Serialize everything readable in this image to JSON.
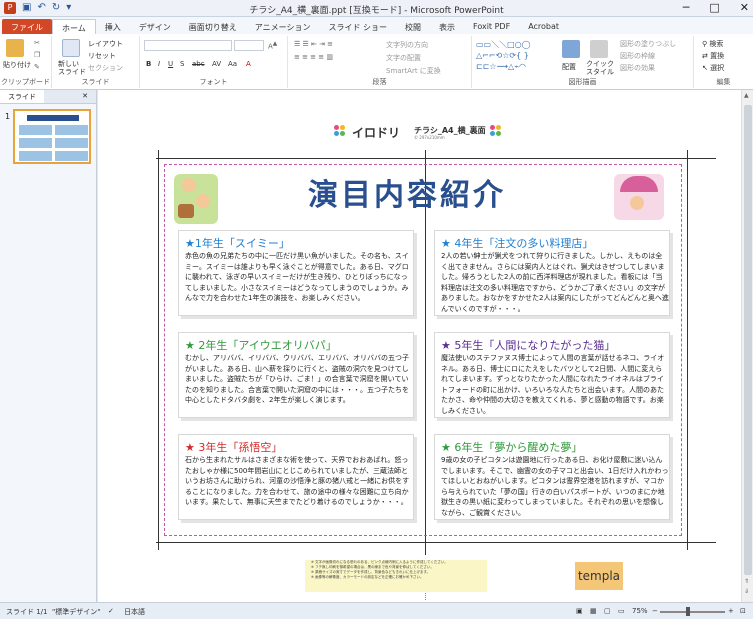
{
  "window": {
    "title": "チラシ_A4_横_裏面.ppt [互換モード] - Microsoft PowerPoint"
  },
  "ribbon_tabs": [
    "ファイル",
    "ホーム",
    "挿入",
    "デザイン",
    "画面切り替え",
    "アニメーション",
    "スライド ショー",
    "校閲",
    "表示",
    "Foxit PDF",
    "Acrobat"
  ],
  "ribbon": {
    "clipboard": {
      "paste": "貼り付け",
      "label": "クリップボード"
    },
    "slides": {
      "new": "新しい\nスライド",
      "layout": "レイアウト",
      "reset": "リセット",
      "section": "セクション",
      "label": "スライド"
    },
    "font": {
      "label": "フォント"
    },
    "paragraph": {
      "direction": "文字列の方向",
      "align": "文字の配置",
      "smartart": "SmartArt に変換",
      "label": "段落"
    },
    "drawing": {
      "arrange": "配置",
      "quickstyle": "クイック\nスタイル",
      "fill": "図形の塗りつぶし",
      "outline": "図形の枠線",
      "effect": "図形の効果",
      "label": "図形描画"
    },
    "editing": {
      "find": "検索",
      "replace": "置換",
      "select": "選択",
      "label": "編集"
    }
  },
  "pane": {
    "tab_outline": "",
    "tab_slides": "スライド",
    "slide_number": "1"
  },
  "slide": {
    "brand": "イロドリ",
    "doc_title": "チラシ_A4_横_裏面",
    "doc_sub": "© 297x210mm",
    "main_title": "演目内容紹介",
    "cards": [
      {
        "title": "★1年生「スイミー」",
        "color": "#1e7fd1",
        "body": "赤色の魚の兄弟たちの中に一匹だけ黒い魚がいました。その名も、スイミー。スイミーは誰よりも早く泳ぐことが得意でした。ある日、マグロに襲われて、泳ぎの早いスイミーだけが生き残り、ひとりぼっちになってしまいました。小さなスイミーはどうなってしまうのでしょうか。みんなで力を合わせた1年生の演技を、お楽しみください。"
      },
      {
        "title": "★ 4年生「注文の多い料理店」",
        "color": "#1e7fd1",
        "body": "2人の若い紳士が猟犬をつれて狩りに行きました。しかし、えものは全く出てきません。さらには案内人とはぐれ、猟犬はきぜつしてしまいました。帰ろうとした2人の前に西洋料理店が現れました。看板には「当料理店は注文の多い料理店ですから、どうかご了承ください」の文字がありました。おなかをすかせた2人は案内にしたがってどんどんと奥へ進んでいくのですが・・・。"
      },
      {
        "title": "★ 2年生「アイウエオリバパ」",
        "color": "#2e9a3a",
        "body": "むかし、アリババ、イリババ、ウリババ、エリババ、オリババの五つ子がいました。ある日、山へ薪を採りに行くと、盗賊の洞穴を見つけてしまいました。盗賊たちが「ひらけ、ごま！」の合言葉で洞窟を開いていたのを知りました。合言葉で開いた洞窟の中には・・・。五つ子たちを中心としたドタバタ劇を、2年生が楽しく演じます。"
      },
      {
        "title": "★ 5年生「人間になりたがった猫」",
        "color": "#5a2f8f",
        "body": "魔法使いのステファヌス博士によって人間の言葉が話せるネコ、ライオネル。ある日、博士にロにたえをしたバツとして2日間、人間に変えられてしまいます。ずっとなりたかった人間になれたライオネルはブライトフォードの町に出かけ、いろいろな人たちと出会います。人間のあたたかさ、命や仲間の大切さを教えてくれる、夢と感動の物語です。お楽しみください。"
      },
      {
        "title": "★ 3年生「孫悟空」",
        "color": "#d42a2a",
        "body": "石から生まれたサルはさまざまな術を使って、天界でおおあばれ。怒ったおしゃか様に500年間岩山にとじこめられていましたが、三蔵法師というお坊さんに助けられ、河童の沙悟浄と豚の猪八戒と一緒にお供をすることになりました。力を合わせて、旅の途中の様々な困難に立ち向かいます。果たして、無事に天竺までたどり着けるのでしょうか・・・。"
      },
      {
        "title": "★ 6年生「夢から醒めた夢」",
        "color": "#2e9a3a",
        "body": "9歳の女の子ピコタンは遊園地に行ったある日、お化け屋敷に迷い込んでしまいます。そこで、幽霊の女の子マコと出会い、1日だけ入れかわってほしいとおねがいします。ピコタンは霊界空港を訪れますが、マコから与えられていた「夢の国」行きの白いパスポートが、いつのまにか地獄生きの黒い紙に変わってしまっていました。それぞれの思いを想像しながら、ご観賞ください。"
      }
    ],
    "bottom_notes": [
      "※ 文字が画像切れになる恐れのある、ピンク点線内側に入るように作成してください。",
      "※ フチ無し印刷を御希望の場合は、黒の線まで色や背景を伸ばしてください。",
      "※ 原稿サイズの実寸でデータを作成し、背景色などもきれいに仕上げます。",
      "※ 画像等の解像度、カラーモードの設定などを正確にお確かめ下さい。"
    ],
    "templa": "templa"
  },
  "status": {
    "slide": "スライド 1/1",
    "theme": "\"標準デザイン\"",
    "lang": "日本語",
    "zoom": "75%"
  }
}
